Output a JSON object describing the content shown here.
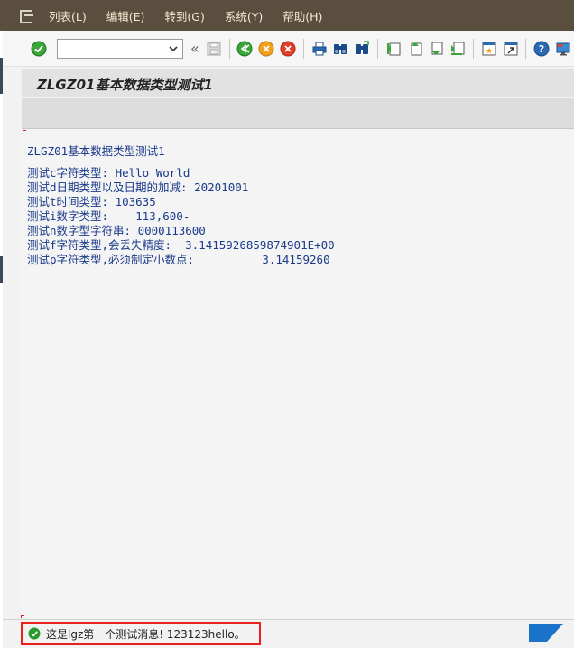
{
  "menu": {
    "items": [
      "列表(L)",
      "编辑(E)",
      "转到(G)",
      "系统(Y)",
      "帮助(H)"
    ]
  },
  "toolbar": {
    "command_value": "",
    "collapse_glyph": "«"
  },
  "title": "ZLGZ01基本数据类型测试1",
  "list": {
    "header": "ZLGZ01基本数据类型测试1",
    "lines": [
      "测试c字符类型: Hello World",
      "测试d日期类型以及日期的加减: 20201001",
      "测试t时间类型: 103635",
      "测试i数字类型:    113,600-",
      "测试n数字型字符串: 0000113600",
      "测试f字符类型,会丢失精度:  3.1415926859874901E+00",
      "测试p字符类型,必须制定小数点:          3.14159260"
    ]
  },
  "status": {
    "message": "这是lgz第一个测试消息! 123123hello。"
  },
  "colors": {
    "menubar": "#5a4f3e",
    "list_text": "#1a3a8a",
    "status_highlight": "#e8211d",
    "ok_green": "#2a9a2a",
    "sap_blue": "#1a73c8"
  }
}
